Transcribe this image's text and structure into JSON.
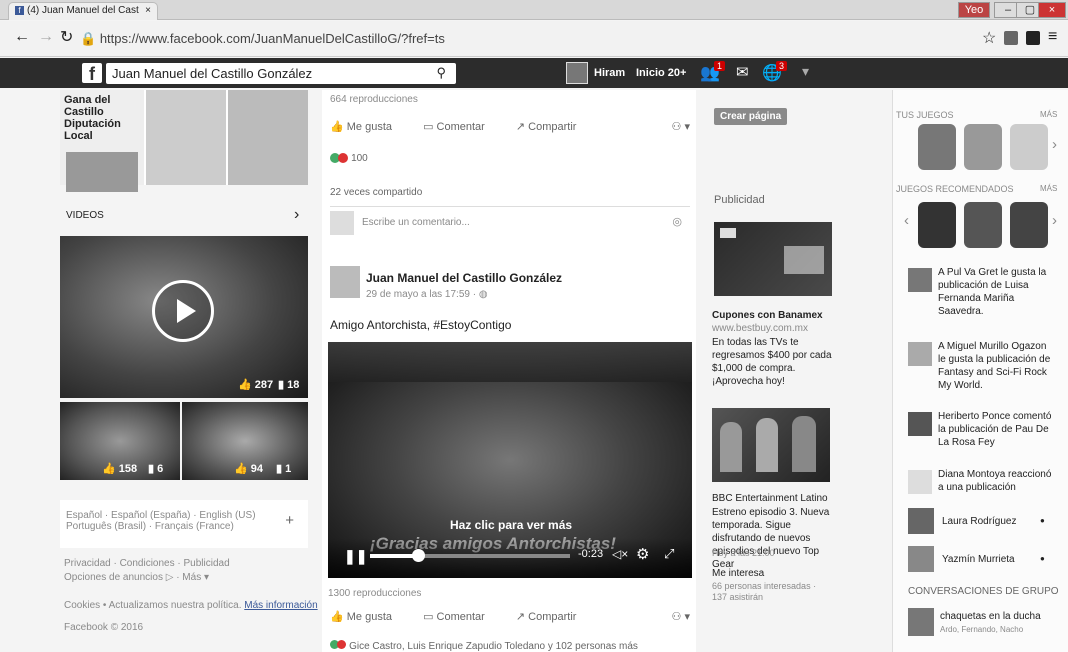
{
  "browser": {
    "tab_title": "(4) Juan Manuel del Cast",
    "tab_close": "×",
    "url": "https://www.facebook.com/JuanManuelDelCastilloG/?fref=ts",
    "user_label": "Yeo",
    "min": "–",
    "max": "▢",
    "close": "×"
  },
  "fb_header": {
    "search_value": "Juan Manuel del Castillo González",
    "user_name": "Hiram",
    "home_label": "Inicio 20+",
    "friend_badge": "1",
    "notif_badge": "3"
  },
  "left": {
    "photo_caption": "Gana del Castillo Diputación Local",
    "videos_label": "VIDEOS",
    "videos_arrow": "›",
    "video_main_likes": "287",
    "video_main_comments": "18",
    "video2_likes": "158",
    "video2_comments": "6",
    "video3_likes": "94",
    "video3_comments": "1",
    "lang_line1": "Español · Español (España) · English (US)",
    "lang_line2": "Português (Brasil) · Français (France)",
    "lang_plus": "+",
    "footer_line1": "Privacidad · Condiciones · Publicidad",
    "footer_line2": "Opciones de anuncios ▷ · Más ▾",
    "footer_line3_a": "Cookies • Actualizamos nuestra política.",
    "footer_line3_b": "Más información",
    "copyright": "Facebook © 2016"
  },
  "feed": {
    "top_views": "664 reproducciones",
    "like": "Me gusta",
    "comment": "Comentar",
    "share": "Compartir",
    "reaction_count": "100",
    "shared_count": "22 veces compartido",
    "comment_placeholder": "Escribe un comentario...",
    "author": "Juan Manuel del Castillo González",
    "post_time": "29 de mayo a las 17:59 · ◍",
    "post_text": "Amigo Antorchista, #EstoyContigo",
    "video_overlay": "Haz clic para ver más",
    "video_banner": "¡Gracias amigos Antorchistas!",
    "video_time": "-0:23",
    "views2": "1300 reproducciones",
    "reactors": "Gice Castro, Luis Enrique Zapudio Toledano y 102 personas más"
  },
  "ads": {
    "create_page": "Crear página",
    "publicidad": "Publicidad",
    "ad1_title": "Cupones con Banamex",
    "ad1_site": "www.bestbuy.com.mx",
    "ad1_body": "En todas las TVs te regresamos $400 por cada $1,000 de compra. ¡Aprovecha hoy!",
    "ad2_title": "BBC Entertainment Latino",
    "ad2_body": "Estreno episodio 3. Nueva temporada. Sigue disfrutando de nuevos episodios del nuevo Top Gear",
    "ad2_time": "Hoy a las 21:00",
    "ad2_interest": "Me interesa",
    "ad2_people": "66 personas interesadas · 137 asistirán"
  },
  "ticker": {
    "games_label": "TUS JUEGOS",
    "more": "MÁS",
    "recommended_label": "JUEGOS RECOMENDADOS",
    "items": [
      {
        "text": "A Pul Va Gret le gusta la publicación de Luisa Fernanda Mariña Saavedra."
      },
      {
        "text": "A Miguel Murillo Ogazon le gusta la publicación de Fantasy and Sci-Fi Rock My World."
      },
      {
        "text": "Heriberto Ponce comentó la publicación de Pau De La Rosa Fey"
      },
      {
        "text": "Diana Montoya reaccionó a una publicación"
      }
    ],
    "contacts": [
      {
        "name": "Laura Rodríguez"
      },
      {
        "name": "Yazmín Murrieta"
      }
    ],
    "group_label": "CONVERSACIONES DE GRUPO",
    "group_name": "chaquetas en la ducha",
    "group_members": "Ardo, Fernando, Nacho",
    "online_dot": "●"
  }
}
